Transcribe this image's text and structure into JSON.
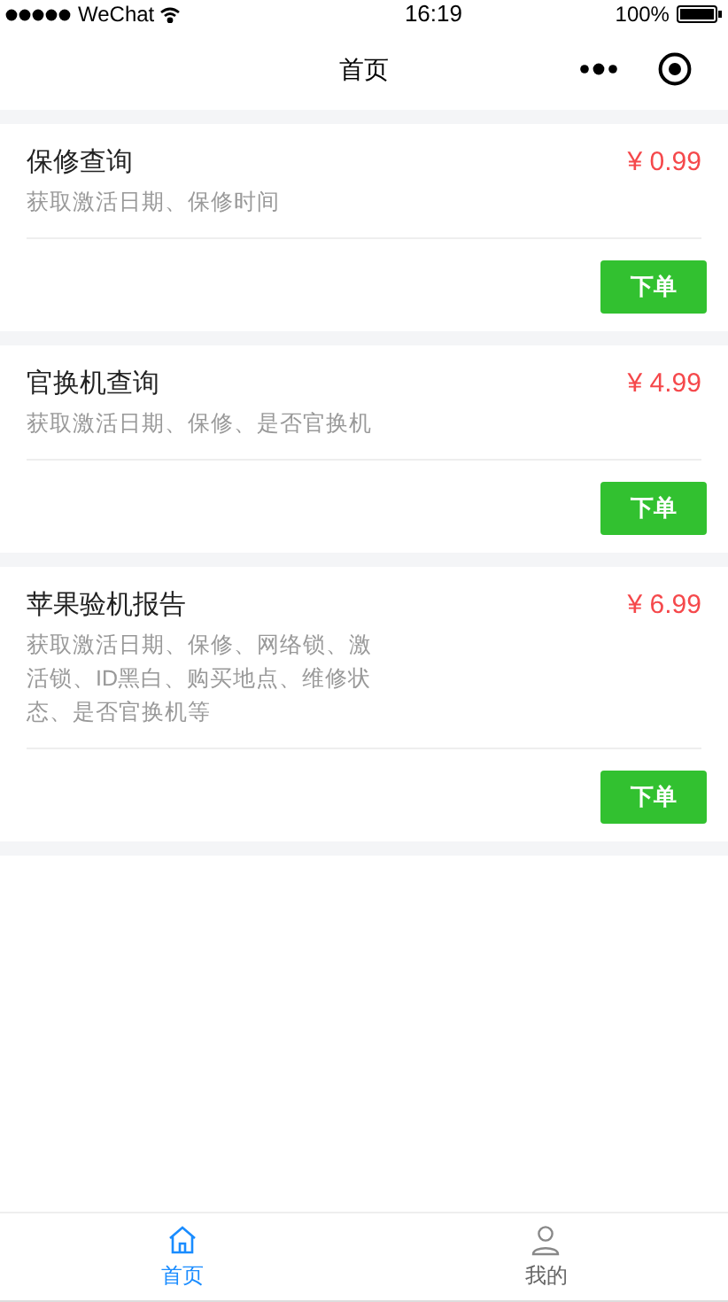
{
  "status_bar": {
    "carrier": "WeChat",
    "time": "16:19",
    "battery": "100%"
  },
  "nav": {
    "title": "首页"
  },
  "products": [
    {
      "title": "保修查询",
      "price": "¥ 0.99",
      "description": "获取激活日期、保修时间",
      "button": "下单"
    },
    {
      "title": "官换机查询",
      "price": "¥ 4.99",
      "description": "获取激活日期、保修、是否官换机",
      "button": "下单"
    },
    {
      "title": "苹果验机报告",
      "price": "¥ 6.99",
      "description": "获取激活日期、保修、网络锁、激活锁、ID黑白、购买地点、维修状态、是否官换机等",
      "button": "下单"
    }
  ],
  "tab_bar": [
    {
      "kind": "home",
      "label": "首页",
      "selected": true
    },
    {
      "kind": "user",
      "label": "我的",
      "selected": false
    }
  ]
}
